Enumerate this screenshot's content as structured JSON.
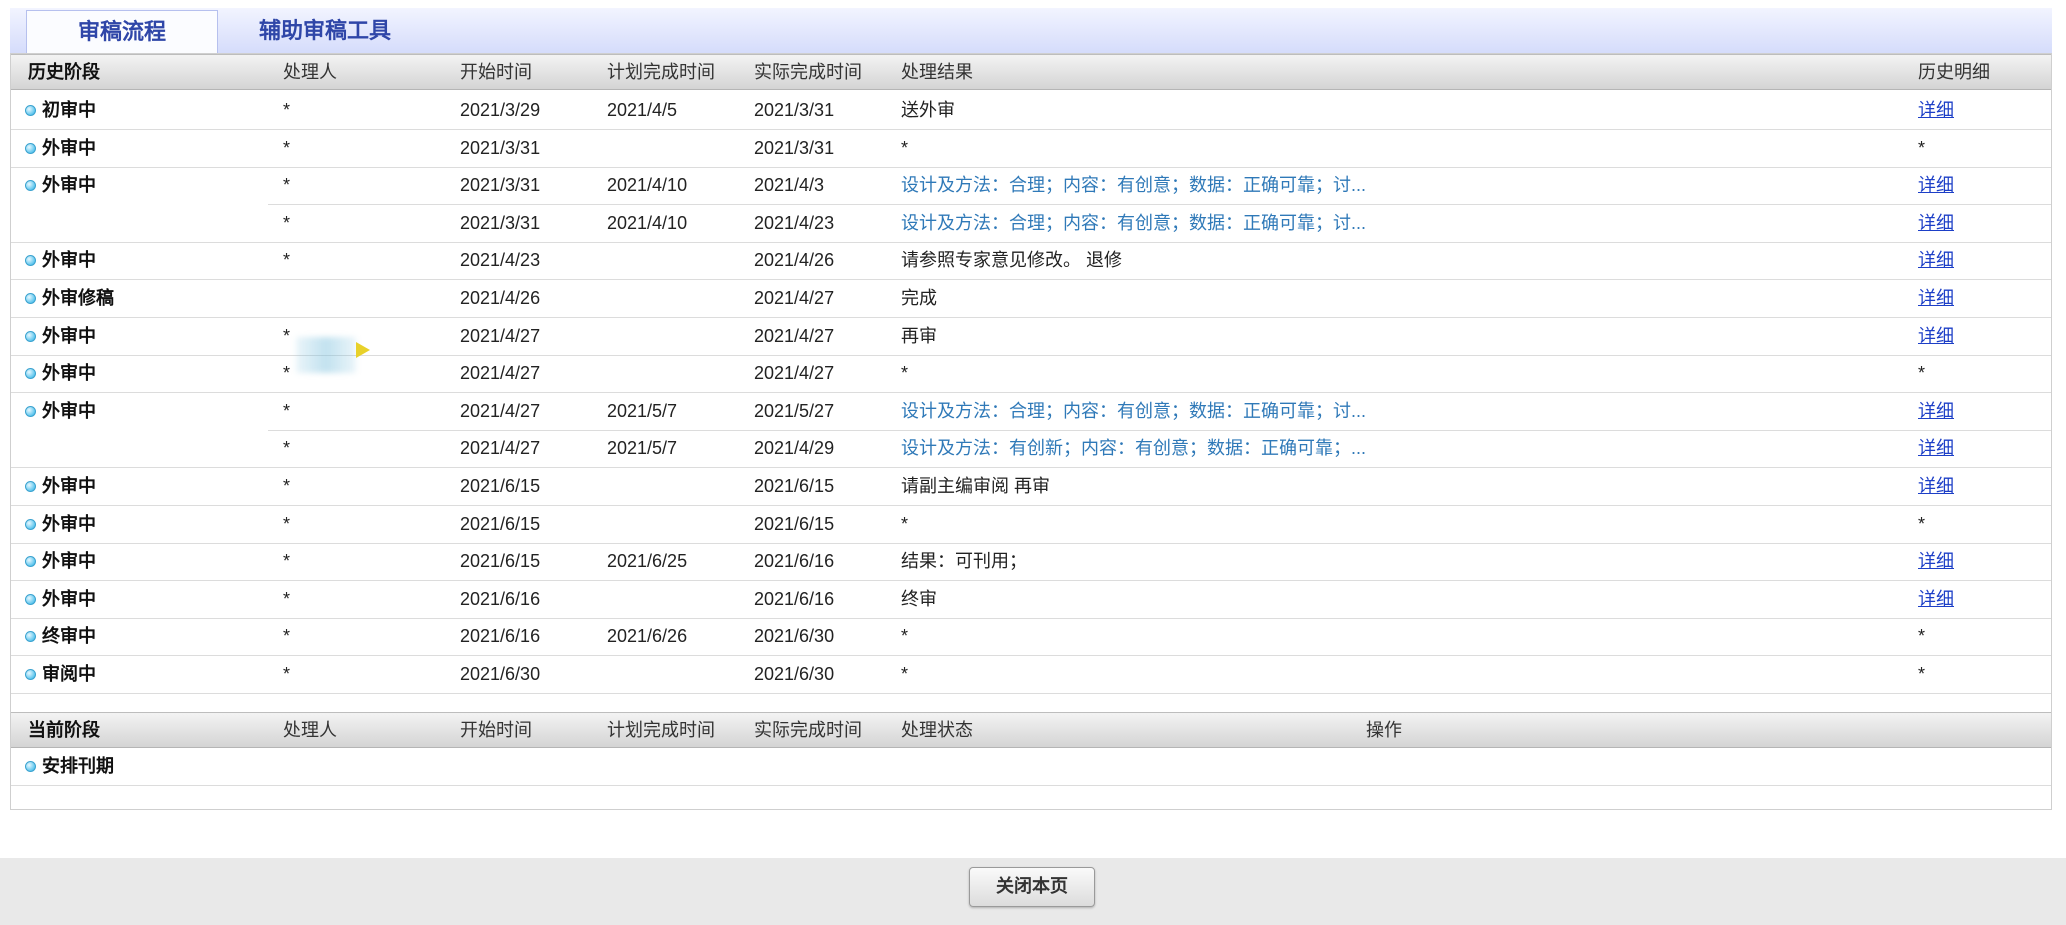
{
  "tabs": [
    {
      "label": "审稿流程",
      "active": true
    },
    {
      "label": "辅助审稿工具",
      "active": false
    }
  ],
  "history": {
    "headers": [
      "历史阶段",
      "处理人",
      "开始时间",
      "计划完成时间",
      "实际完成时间",
      "处理结果",
      "历史明细"
    ],
    "rows": [
      {
        "stage": "初审中",
        "handler": "*",
        "start": "2021/3/29",
        "plan": "2021/4/5",
        "actual": "2021/3/31",
        "result": "送外审",
        "result_link": false,
        "detail": "详细",
        "detail_link": true
      },
      {
        "stage": "外审中",
        "handler": "*",
        "start": "2021/3/31",
        "plan": "",
        "actual": "2021/3/31",
        "result": "*",
        "result_link": false,
        "detail": "*",
        "detail_link": false
      },
      {
        "stage": "外审中",
        "handler": "*",
        "start": "2021/3/31",
        "plan": "2021/4/10",
        "actual": "2021/4/3",
        "result": "设计及方法：合理；内容：有创意；数据：正确可靠；讨...",
        "result_link": true,
        "detail": "详细",
        "detail_link": true
      },
      {
        "stage": "",
        "handler": "*",
        "start": "2021/3/31",
        "plan": "2021/4/10",
        "actual": "2021/4/23",
        "result": "设计及方法：合理；内容：有创意；数据：正确可靠；讨...",
        "result_link": true,
        "detail": "详细",
        "detail_link": true
      },
      {
        "stage": "外审中",
        "handler": "*",
        "start": "2021/4/23",
        "plan": "",
        "actual": "2021/4/26",
        "result": "请参照专家意见修改。 退修",
        "result_link": false,
        "detail": "详细",
        "detail_link": true
      },
      {
        "stage": "外审修稿",
        "handler": "",
        "start": "2021/4/26",
        "plan": "",
        "actual": "2021/4/27",
        "result": "完成",
        "result_link": false,
        "detail": "详细",
        "detail_link": true
      },
      {
        "stage": "外审中",
        "handler": "*",
        "start": "2021/4/27",
        "plan": "",
        "actual": "2021/4/27",
        "result": "再审",
        "result_link": false,
        "detail": "详细",
        "detail_link": true
      },
      {
        "stage": "外审中",
        "handler": "*",
        "start": "2021/4/27",
        "plan": "",
        "actual": "2021/4/27",
        "result": "*",
        "result_link": false,
        "detail": "*",
        "detail_link": false
      },
      {
        "stage": "外审中",
        "handler": "*",
        "start": "2021/4/27",
        "plan": "2021/5/7",
        "actual": "2021/5/27",
        "result": "设计及方法：合理；内容：有创意；数据：正确可靠；讨...",
        "result_link": true,
        "detail": "详细",
        "detail_link": true
      },
      {
        "stage": "",
        "handler": "*",
        "start": "2021/4/27",
        "plan": "2021/5/7",
        "actual": "2021/4/29",
        "result": "设计及方法：有创新；内容：有创意；数据：正确可靠；...",
        "result_link": true,
        "detail": "详细",
        "detail_link": true
      },
      {
        "stage": "外审中",
        "handler": "*",
        "start": "2021/6/15",
        "plan": "",
        "actual": "2021/6/15",
        "result": "请副主编审阅 再审",
        "result_link": false,
        "detail": "详细",
        "detail_link": true
      },
      {
        "stage": "外审中",
        "handler": "*",
        "start": "2021/6/15",
        "plan": "",
        "actual": "2021/6/15",
        "result": "*",
        "result_link": false,
        "detail": "*",
        "detail_link": false
      },
      {
        "stage": "外审中",
        "handler": "*",
        "start": "2021/6/15",
        "plan": "2021/6/25",
        "actual": "2021/6/16",
        "result": "结果：可刊用；",
        "result_link": false,
        "detail": "详细",
        "detail_link": true
      },
      {
        "stage": "外审中",
        "handler": "*",
        "start": "2021/6/16",
        "plan": "",
        "actual": "2021/6/16",
        "result": "终审",
        "result_link": false,
        "detail": "详细",
        "detail_link": true
      },
      {
        "stage": "终审中",
        "handler": "*",
        "start": "2021/6/16",
        "plan": "2021/6/26",
        "actual": "2021/6/30",
        "result": "*",
        "result_link": false,
        "detail": "*",
        "detail_link": false
      },
      {
        "stage": "审阅中",
        "handler": "*",
        "start": "2021/6/30",
        "plan": "",
        "actual": "2021/6/30",
        "result": "*",
        "result_link": false,
        "detail": "*",
        "detail_link": false
      }
    ]
  },
  "current": {
    "headers": [
      "当前阶段",
      "处理人",
      "开始时间",
      "计划完成时间",
      "实际完成时间",
      "处理状态",
      "操作"
    ],
    "rows": [
      {
        "stage": "安排刊期"
      }
    ]
  },
  "footer": {
    "close_label": "关闭本页"
  },
  "colors": {
    "tab_text": "#2f46a8",
    "link": "#1d3fc7",
    "result_link": "#2f79b8",
    "bullet": "#5ec6ee"
  }
}
